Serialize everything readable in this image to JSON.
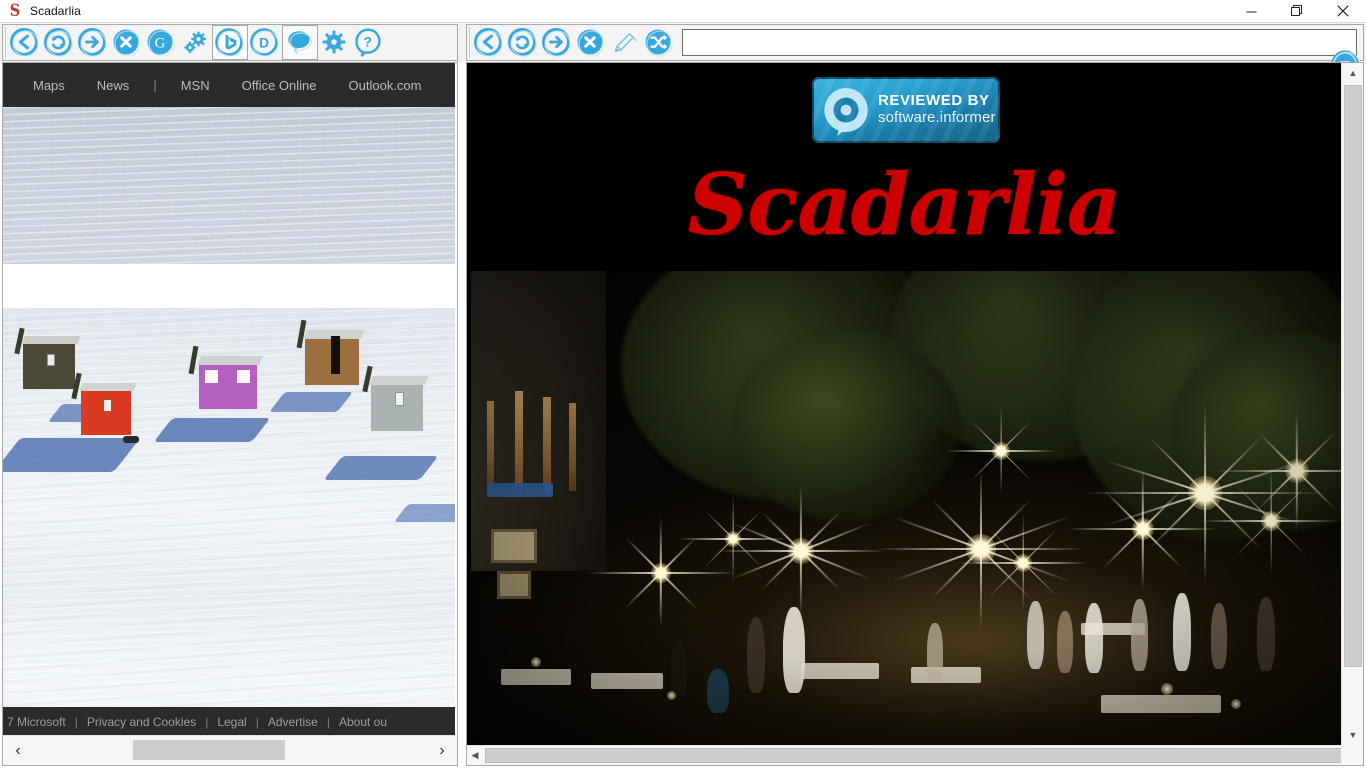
{
  "window": {
    "title": "Scadarlia",
    "app_icon": "scadarlia-s-logo",
    "controls": {
      "minimize": "minimize-icon",
      "restore": "restore-icon",
      "close": "close-icon"
    }
  },
  "toolbar_left": {
    "buttons": [
      {
        "name": "back-button",
        "icon": "back-arrow-circle-icon",
        "label": "Back"
      },
      {
        "name": "refresh-button",
        "icon": "refresh-circle-icon",
        "label": "Refresh"
      },
      {
        "name": "forward-button",
        "icon": "forward-arrow-circle-icon",
        "label": "Forward"
      },
      {
        "name": "stop-button",
        "icon": "stop-x-circle-icon",
        "label": "Stop"
      },
      {
        "name": "google-button",
        "icon": "google-g-circle-icon",
        "label": "Google"
      },
      {
        "name": "gears-button",
        "icon": "gears-icon",
        "label": "Tools"
      },
      {
        "name": "bing-button",
        "icon": "bing-play-circle-icon",
        "label": "Bing"
      },
      {
        "name": "duckduckgo-button",
        "icon": "letter-d-circle-icon",
        "label": "DuckDuckGo"
      },
      {
        "name": "chat-button",
        "icon": "speech-bubble-icon",
        "label": "Chat"
      },
      {
        "name": "settings-button",
        "icon": "gear-icon",
        "label": "Settings"
      },
      {
        "name": "help-button",
        "icon": "question-mark-circle-icon",
        "label": "Help"
      }
    ]
  },
  "toolbar_right": {
    "buttons": [
      {
        "name": "back-button",
        "icon": "back-arrow-circle-icon",
        "label": "Back"
      },
      {
        "name": "refresh-button",
        "icon": "refresh-circle-icon",
        "label": "Refresh"
      },
      {
        "name": "forward-button",
        "icon": "forward-arrow-circle-icon",
        "label": "Forward"
      },
      {
        "name": "stop-button",
        "icon": "stop-x-circle-icon",
        "label": "Stop"
      },
      {
        "name": "edit-button",
        "icon": "pencil-icon",
        "label": "Edit"
      },
      {
        "name": "shuffle-button",
        "icon": "shuffle-arrows-circle-icon",
        "label": "Shuffle"
      }
    ],
    "address_bar": {
      "value": "",
      "placeholder": ""
    },
    "go_button": {
      "icon": "chevron-down-circle-icon",
      "label": "Go"
    }
  },
  "left_page": {
    "nav": [
      {
        "label": "Maps",
        "type": "link"
      },
      {
        "label": "News",
        "type": "link"
      },
      {
        "label": "|",
        "type": "divider"
      },
      {
        "label": "MSN",
        "type": "link"
      },
      {
        "label": "Office Online",
        "type": "link"
      },
      {
        "label": "Outlook.com",
        "type": "link"
      }
    ],
    "search_box": {
      "value": "",
      "placeholder": ""
    },
    "hero_image": "snow-field-with-colored-ice-fishing-huts",
    "huts": [
      {
        "name": "olive-hut",
        "color": "#4b4a36"
      },
      {
        "name": "red-hut",
        "color": "#d93b22"
      },
      {
        "name": "purple-hut",
        "color": "#b560c0"
      },
      {
        "name": "brown-hut",
        "color": "#9d6e3e"
      },
      {
        "name": "gray-hut",
        "color": "#aab3b0"
      }
    ],
    "footer": [
      {
        "label": "7 Microsoft"
      },
      {
        "label": "Privacy and Cookies"
      },
      {
        "label": "Legal"
      },
      {
        "label": "Advertise"
      },
      {
        "label": "About ou"
      }
    ],
    "footer_separator": "|",
    "scroll": {
      "left_arrow": "‹",
      "right_arrow": "›"
    }
  },
  "right_page": {
    "badge": {
      "line1": "REVIEWED BY",
      "line2": "software.informer",
      "icon": "magnifier-speech-bubble-icon",
      "color": "#1b8cba"
    },
    "logo": {
      "text": "Scadarlia",
      "color": "#cc0000"
    },
    "photo": "night-street-cafe-with-starburst-lights",
    "scroll": {
      "up_arrow": "▲",
      "down_arrow": "▼",
      "left_arrow": "◀",
      "right_arrow": "▶"
    }
  },
  "colors": {
    "accent": "#37a8dd",
    "toolbar_bg": "#f4f4f4",
    "nav_bg": "#2b2b2b",
    "logo_red": "#cc0000"
  }
}
